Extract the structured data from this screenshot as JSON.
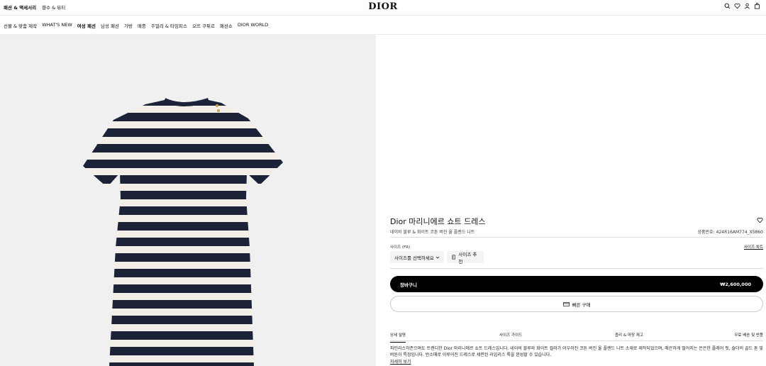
{
  "header": {
    "top_nav": [
      "패션 & 액세서리",
      "향수 & 뷰티"
    ],
    "logo": "DIOR",
    "icons": [
      "search-icon",
      "heart-icon",
      "user-icon",
      "bag-icon"
    ]
  },
  "category_nav": [
    "선물 & 맞춤 제작",
    "WHAT'S NEW",
    "여성 패션",
    "남성 패션",
    "가방",
    "매종",
    "주얼리 & 타임피스",
    "오뜨 쿠튀르",
    "패션쇼",
    "DIOR WORLD"
  ],
  "product": {
    "title": "Dior 마리니에르 쇼트 드레스",
    "subtitle": "네이비 블루 & 화이트 코튼 버진 울 플렌드 니트",
    "sku_label": "상품번호:",
    "sku": "424R16AM774_X5860",
    "size_label": "사이즈 (FR)",
    "size_chart": "사이즈 차트",
    "size_select": "사이즈를 선택하세요",
    "size_recommend": "사이즈 추천",
    "cart_label": "장바구니",
    "price": "₩2,600,000",
    "quick_buy": "빠른 구매"
  },
  "tabs": [
    "상세 설명",
    "사이즈 가이드",
    "옵리 & 마장 재고",
    "무료 배송 및 반품"
  ],
  "description": {
    "text": "파인리스하존으며도 트렌디한 Dior 마리니에르 쇼트 드레스입니다. 네이비 블루와 화이트 컬러가 어우러진 코튼 버진 울 플렌드 니트 소재로 제작되었으며, 매끈하게 떨어지는 은은한 플레어 핏, 숄더의 골드 톤 및 버튼이 특징입니다. 반소매로 이루어진 드레스로 세련된 라임리스 룩을 완성할 수 있습니다.",
    "more": "자세히 보기"
  },
  "colors": {
    "navy": "#1c2237",
    "cream": "#f3efe6",
    "bg_image": "#f0f0f0"
  }
}
